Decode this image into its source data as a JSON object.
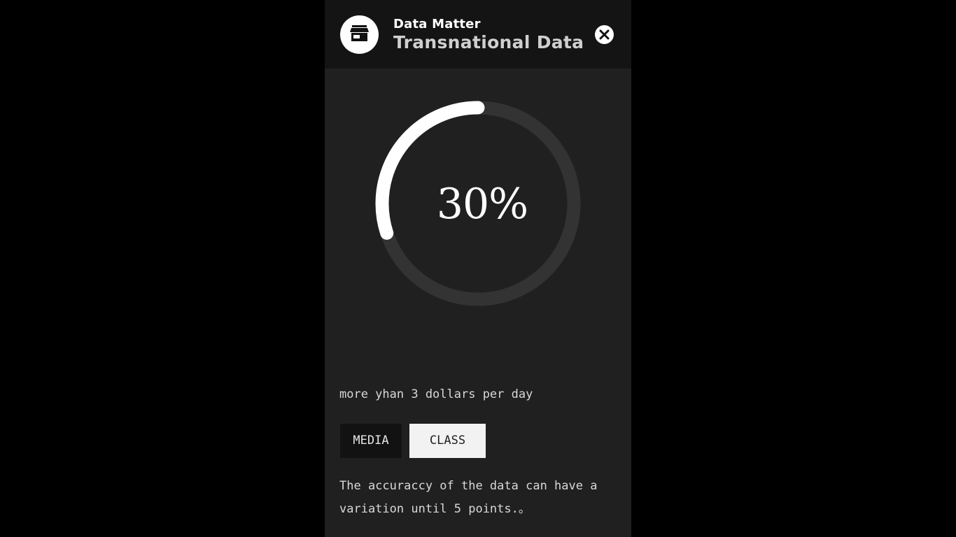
{
  "header": {
    "subtitle": "Data Matter",
    "title": "Transnational Data",
    "avatar_icon": "store-icon",
    "close_icon": "close-icon"
  },
  "gauge": {
    "value": 30,
    "label": "30%",
    "track_color": "#333333",
    "fill_color": "#ffffff"
  },
  "description": "more yhan 3 dollars per day",
  "buttons": {
    "media": "MEDIA",
    "class": "CLASS"
  },
  "note": "The accuraccy of the data can have a variation until 5 points.。",
  "colors": {
    "panel": "#202020",
    "header": "#141414",
    "background": "#000000"
  }
}
